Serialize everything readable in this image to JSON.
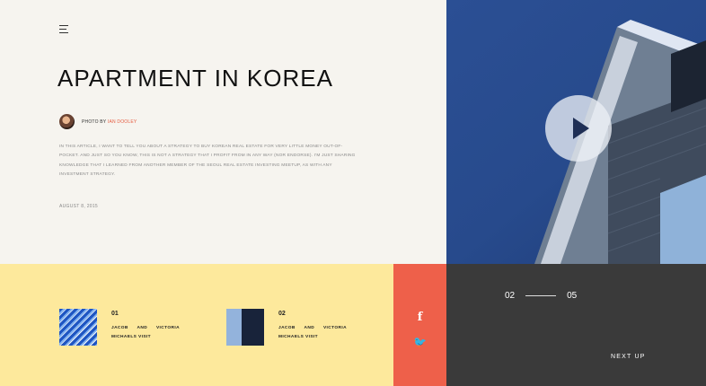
{
  "article": {
    "title": "APARTMENT IN KOREA",
    "photo_by": "PHOTO BY",
    "author": "IAN DOOLEY",
    "body": "IN THIS ARTICLE, I WANT TO TELL YOU ABOUT A STRATEGY TO BUY KOREAN REAL ESTATE FOR VERY LITTLE MONEY OUT-OF-POCKET. AND JUST SO YOU KNOW, THIS IS NOT A STRATEGY THAT I PROFIT FROM IN ANY WAY (NOR ENDORSE). I'M JUST SHARING KNOWLEDGE THAT I LEARNED FROM ANOTHER MEMBER OF THE SEOUL REAL ESTATE INVESTING MEETUP, AS WITH ANY INVESTMENT STRATEGY.",
    "date": "AUGUST 8, 2015"
  },
  "cards": [
    {
      "number": "01",
      "caption": "JACOB AND VICTORIA MICHAELS VISIT"
    },
    {
      "number": "02",
      "caption": "JACOB AND VICTORIA MICHAELS VISIT"
    }
  ],
  "social": {
    "facebook": "f",
    "twitter": "🐦"
  },
  "pager": {
    "current": "02",
    "total": "05",
    "next_label": "NEXT UP"
  },
  "icons": [
    "menu-icon",
    "play-icon",
    "facebook-icon",
    "twitter-icon"
  ],
  "colors": {
    "yellow": "#fde99c",
    "coral": "#ee604a",
    "dark": "#3a3a3a",
    "accent": "#e55b40",
    "blue": "#274a8c"
  }
}
